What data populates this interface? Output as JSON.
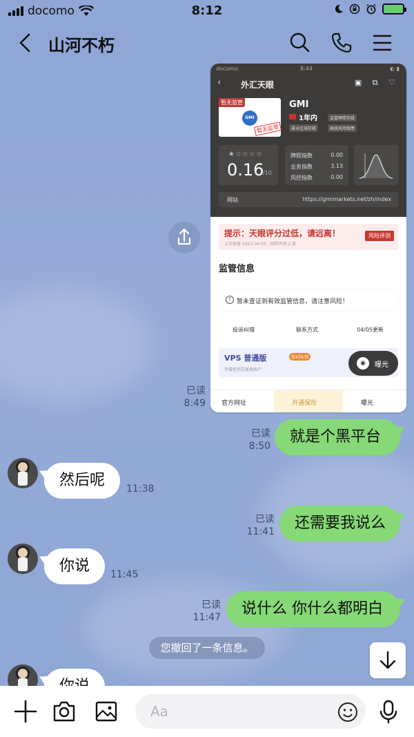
{
  "status_bar": {
    "carrier": "docomo",
    "time": "8:12"
  },
  "header": {
    "title": "山河不朽",
    "icons": [
      "back-icon",
      "search-icon",
      "phone-icon",
      "menu-icon"
    ]
  },
  "shared_screenshot": {
    "status_time": "8:44",
    "carrier": "docomo",
    "nav_title": "外汇天眼",
    "broker_name": "GMI",
    "regulation_tag": "暂无监管",
    "stamp": "暂无监管",
    "age": "1年内",
    "chips": [
      "监管牌照存疑",
      "属业区域存疑",
      "高级风险隐患"
    ],
    "score": "0.16",
    "score_unit": "/10",
    "indices": [
      {
        "label": "牌照指数",
        "value": "0.00"
      },
      {
        "label": "业务指数",
        "value": "3.13"
      },
      {
        "label": "风控指数",
        "value": "0.00"
      }
    ],
    "website_label": "网站",
    "website_url": "https://gmimarkets.net/zh/index",
    "warning_title": "提示：天眼评分过低，请远离！",
    "warning_sub": "上次核查 2023-04-05 · 风险评测 2 条",
    "warning_button": "风险评测",
    "section_title": "监管信息",
    "notice": "暂未查证到有效监管信息，请注意风险！",
    "actions": [
      "投诉纠错",
      "联系方式",
      "04/05更新"
    ],
    "vps_title": "VPS 普通版",
    "vps_tag": "仅¥30/月",
    "vps_sub": "不做任何交易真账户",
    "expose_label": "曝光",
    "bottom_official": "官方网址",
    "bottom_apply": "开通保险",
    "bottom_expose": "曝光"
  },
  "messages": [
    {
      "side": "out",
      "read": "已读",
      "time": "8:49",
      "text": ""
    },
    {
      "side": "out",
      "read": "已读",
      "time": "8:50",
      "text": "就是个黑平台"
    },
    {
      "side": "in",
      "time": "11:38",
      "text": "然后呢"
    },
    {
      "side": "out",
      "read": "已读",
      "time": "11:41",
      "text": "还需要我说么"
    },
    {
      "side": "in",
      "time": "11:45",
      "text": "你说"
    },
    {
      "side": "out",
      "read": "已读",
      "time": "11:47",
      "text": "说什么 你什么都明白"
    },
    {
      "side": "system",
      "text": "您撤回了一条信息。"
    },
    {
      "side": "in",
      "text": "你说"
    }
  ],
  "input": {
    "placeholder": "Aa"
  },
  "colors": {
    "outgoing_bubble": "#86d976",
    "incoming_bubble": "#ffffff",
    "background": "#8fa6d6"
  }
}
